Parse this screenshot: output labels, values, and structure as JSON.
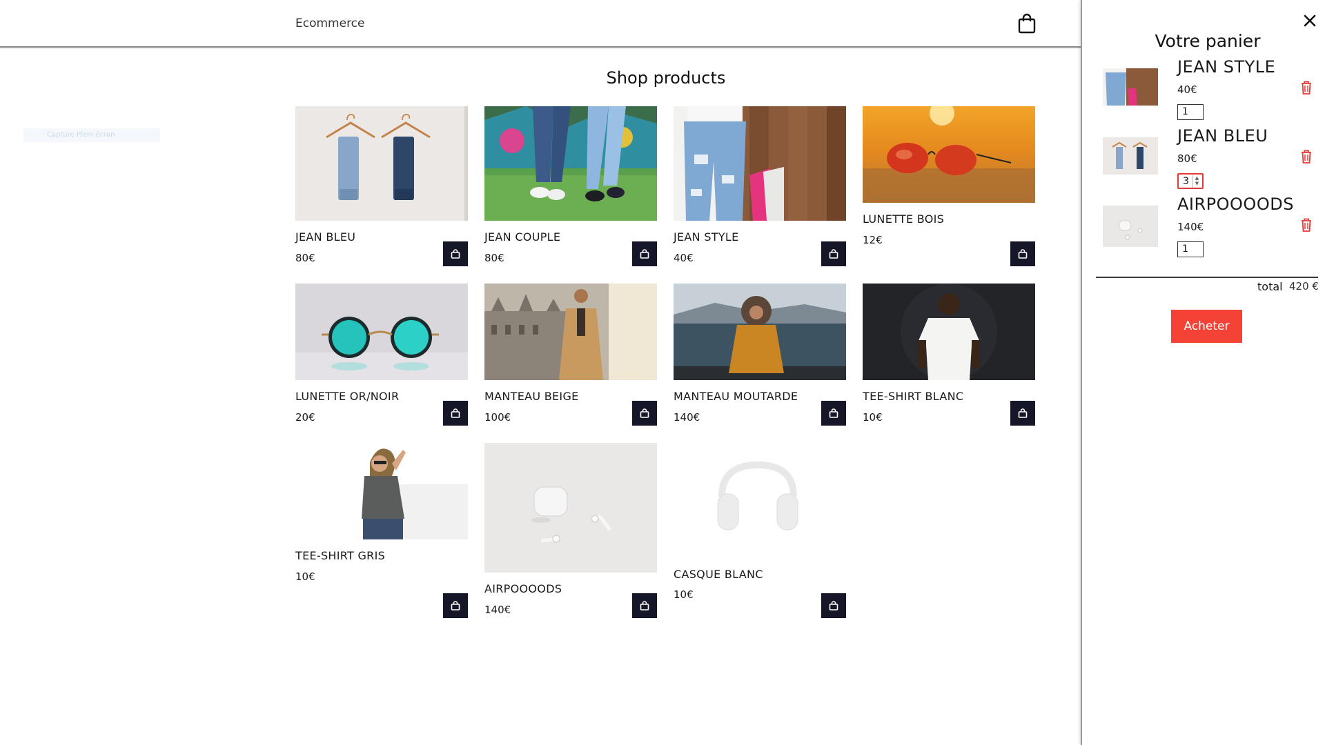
{
  "header": {
    "brand": "Ecommerce",
    "bag_icon": "shopping-bag-icon"
  },
  "ghost_tab": {
    "label": "Capture Plein écran"
  },
  "main": {
    "title": "Shop products"
  },
  "products": [
    {
      "name": "JEAN BLEU",
      "price": "80€",
      "image": "jeans-on-hangers"
    },
    {
      "name": "JEAN COUPLE",
      "price": "80€",
      "image": "couple-legs-jeans"
    },
    {
      "name": "JEAN STYLE",
      "price": "40€",
      "image": "ripped-jeans-shopping"
    },
    {
      "name": "LUNETTE BOIS",
      "price": "12€",
      "image": "aviator-sunglasses-sunset"
    },
    {
      "name": "LUNETTE OR/NOIR",
      "price": "20€",
      "image": "round-teal-sunglasses"
    },
    {
      "name": "MANTEAU BEIGE",
      "price": "100€",
      "image": "man-beige-coat"
    },
    {
      "name": "MANTEAU MOUTARDE",
      "price": "140€",
      "image": "mustard-parka-lake"
    },
    {
      "name": "TEE-SHIRT BLANC",
      "price": "10€",
      "image": "man-white-tshirt"
    },
    {
      "name": "TEE-SHIRT GRIS",
      "price": "10€",
      "image": "woman-grey-tshirt"
    },
    {
      "name": "AIRPOOOODS",
      "price": "140€",
      "image": "white-earbuds"
    },
    {
      "name": "CASQUE BLANC",
      "price": "10€",
      "image": "white-headphones"
    }
  ],
  "cart": {
    "title": "Votre panier",
    "close_icon": "close-icon",
    "items": [
      {
        "name": "JEAN STYLE",
        "price": "40€",
        "qty": "1",
        "image": "ripped-jeans-shopping"
      },
      {
        "name": "JEAN BLEU",
        "price": "80€",
        "qty": "3",
        "image": "jeans-on-hangers"
      },
      {
        "name": "AIRPOOOODS",
        "price": "140€",
        "qty": "1",
        "image": "white-earbuds"
      }
    ],
    "total_label": "total",
    "total_value": "420 €",
    "buy_label": "Acheter"
  },
  "colors": {
    "cart_button": "#161629",
    "accent_red": "#f44336",
    "trash_red": "#e53935"
  }
}
